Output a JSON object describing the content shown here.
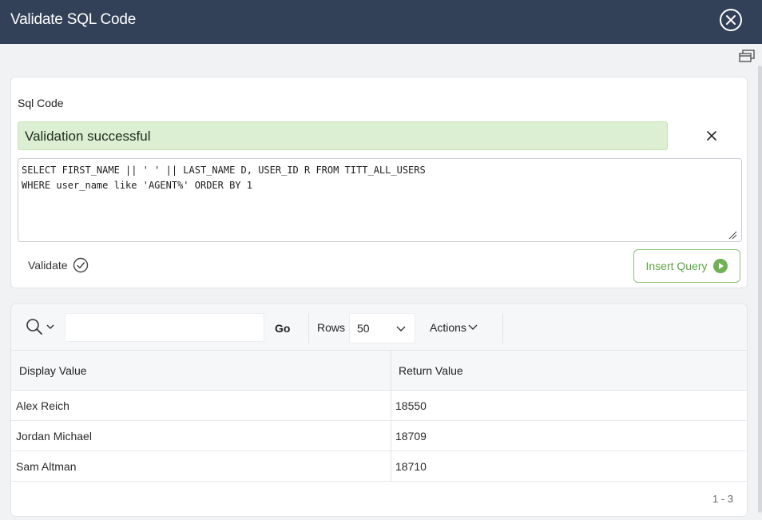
{
  "dialog": {
    "title": "Validate SQL Code"
  },
  "sql_region": {
    "label": "Sql Code",
    "banner_text": "Validation successful",
    "code": "SELECT FIRST_NAME || ' ' || LAST_NAME D, USER_ID R FROM TITT_ALL_USERS\nWHERE user_name like 'AGENT%' ORDER BY 1",
    "validate_label": "Validate",
    "insert_label": "Insert Query"
  },
  "toolbar": {
    "search_value": "",
    "go_label": "Go",
    "rows_label": "Rows",
    "rows_value": "50",
    "actions_label": "Actions"
  },
  "grid": {
    "columns": [
      "Display Value",
      "Return Value"
    ],
    "rows": [
      [
        "Alex Reich",
        "18550"
      ],
      [
        "Jordan Michael",
        "18709"
      ],
      [
        "Sam Altman",
        "18710"
      ]
    ],
    "pagination": "1 - 3"
  },
  "colors": {
    "titlebar": "#324058",
    "success_bg": "#dcefd2",
    "accent_green": "#5aa441"
  },
  "icons": {
    "close": "close-circle-icon",
    "restore": "restore-window-icon",
    "banner_close": "close-icon",
    "validate": "check-circle-icon",
    "insert": "play-circle-icon",
    "search": "search-icon",
    "chevron": "chevron-down-icon"
  }
}
